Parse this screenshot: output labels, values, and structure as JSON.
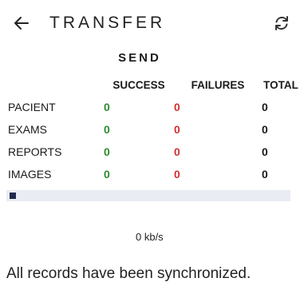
{
  "header": {
    "title": "TRANSFER"
  },
  "section": {
    "heading": "SEND"
  },
  "table": {
    "columns": [
      "SUCCESS",
      "FAILURES",
      "TOTAL"
    ],
    "rows": [
      {
        "label": "PACIENT",
        "success": "0",
        "failures": "0",
        "total": "0"
      },
      {
        "label": "EXAMS",
        "success": "0",
        "failures": "0",
        "total": "0"
      },
      {
        "label": "REPORTS",
        "success": "0",
        "failures": "0",
        "total": "0"
      },
      {
        "label": "IMAGES",
        "success": "0",
        "failures": "0",
        "total": "0"
      }
    ]
  },
  "progress": {
    "fraction": 0.02
  },
  "speed": "0 kb/s",
  "status": "All records have been synchronized.",
  "colors": {
    "success": "#2e8b2e",
    "failure": "#d32f2f",
    "progress_fill": "#1f2a4d",
    "progress_track": "#e9ecf3"
  },
  "icons": {
    "back": "arrow-left-icon",
    "refresh": "refresh-icon"
  }
}
